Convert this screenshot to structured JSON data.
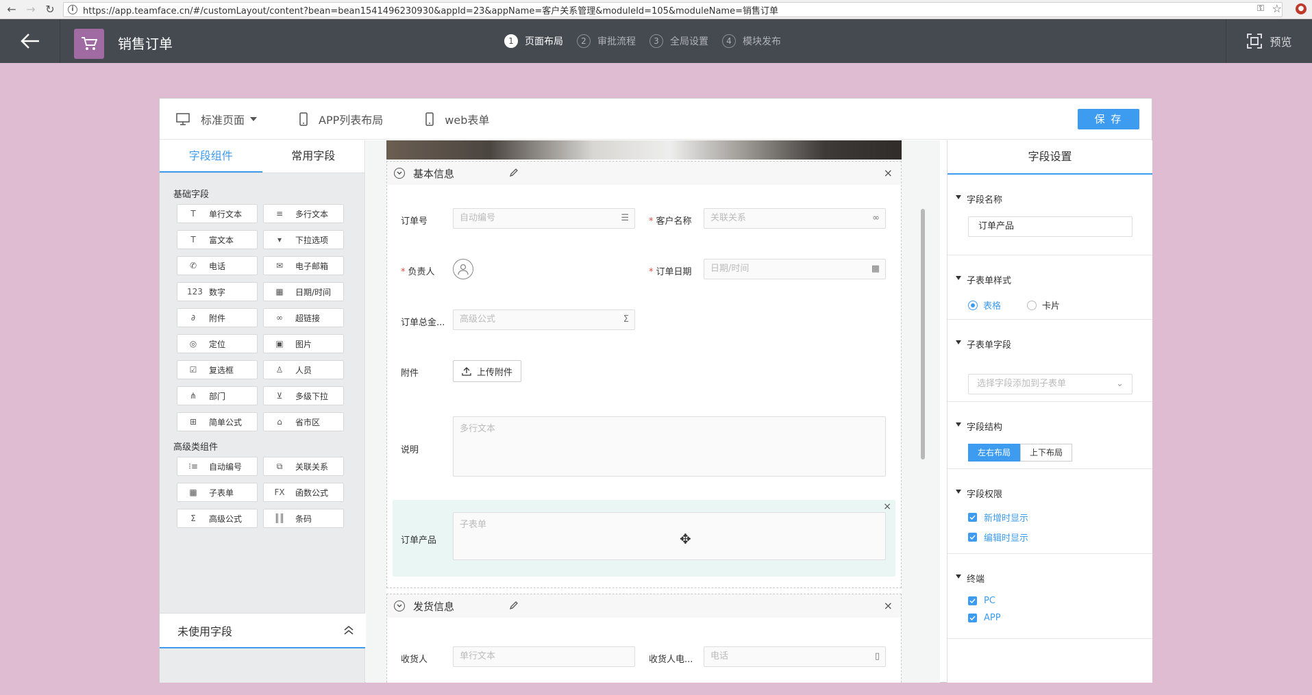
{
  "browser": {
    "url": "https://app.teamface.cn/#/customLayout/content?bean=bean1541496230930&appId=23&appName=客户关系管理&moduleId=105&moduleName=销售订单"
  },
  "header": {
    "title": "销售订单",
    "steps": [
      {
        "num": "1",
        "label": "页面布局",
        "active": true
      },
      {
        "num": "2",
        "label": "审批流程",
        "active": false
      },
      {
        "num": "3",
        "label": "全局设置",
        "active": false
      },
      {
        "num": "4",
        "label": "模块发布",
        "active": false
      }
    ],
    "preview_label": "预览",
    "app_icon_color": "#a06aa3",
    "header_bg": "#454a50"
  },
  "toolbar": {
    "standard_page": "标准页面",
    "app_list_layout": "APP列表布局",
    "web_form": "web表单",
    "save_label": "保 存"
  },
  "left": {
    "tabs": [
      "字段组件",
      "常用字段"
    ],
    "basic_title": "基础字段",
    "basic": [
      {
        "label": "单行文本",
        "icon": "single-text-icon",
        "glyph": "T"
      },
      {
        "label": "多行文本",
        "icon": "multi-text-icon",
        "glyph": "≡"
      },
      {
        "label": "富文本",
        "icon": "rich-text-icon",
        "glyph": "T"
      },
      {
        "label": "下拉选项",
        "icon": "dropdown-icon",
        "glyph": "▾"
      },
      {
        "label": "电话",
        "icon": "phone-icon",
        "glyph": "✆"
      },
      {
        "label": "电子邮箱",
        "icon": "mail-icon",
        "glyph": "✉"
      },
      {
        "label": "数字",
        "icon": "number-icon",
        "glyph": "123"
      },
      {
        "label": "日期/时间",
        "icon": "calendar-icon",
        "glyph": "▦"
      },
      {
        "label": "附件",
        "icon": "attachment-icon",
        "glyph": "∂"
      },
      {
        "label": "超链接",
        "icon": "link-icon",
        "glyph": "∞"
      },
      {
        "label": "定位",
        "icon": "location-icon",
        "glyph": "◎"
      },
      {
        "label": "图片",
        "icon": "image-icon",
        "glyph": "▣"
      },
      {
        "label": "复选框",
        "icon": "checkbox-icon",
        "glyph": "☑"
      },
      {
        "label": "人员",
        "icon": "person-icon",
        "glyph": "♙"
      },
      {
        "label": "部门",
        "icon": "department-icon",
        "glyph": "⋔"
      },
      {
        "label": "多级下拉",
        "icon": "multi-dropdown-icon",
        "glyph": "⊻"
      },
      {
        "label": "简单公式",
        "icon": "simple-formula-icon",
        "glyph": "⊞"
      },
      {
        "label": "省市区",
        "icon": "region-icon",
        "glyph": "⌂"
      }
    ],
    "advanced_title": "高级类组件",
    "advanced": [
      {
        "label": "自动编号",
        "icon": "auto-number-icon",
        "glyph": "⁝≡"
      },
      {
        "label": "关联关系",
        "icon": "relation-icon",
        "glyph": "⧉"
      },
      {
        "label": "子表单",
        "icon": "subform-icon",
        "glyph": "▦"
      },
      {
        "label": "函数公式",
        "icon": "function-icon",
        "glyph": "FX"
      },
      {
        "label": "高级公式",
        "icon": "sigma-icon",
        "glyph": "Σ"
      },
      {
        "label": "条码",
        "icon": "barcode-icon",
        "glyph": "║║"
      }
    ],
    "unused_label": "未使用字段"
  },
  "form": {
    "section1": {
      "title": "基本信息",
      "order_no_label": "订单号",
      "order_no_placeholder": "自动编号",
      "customer_label": "客户名称",
      "customer_placeholder": "关联关系",
      "owner_label": "负责人",
      "date_label": "订单日期",
      "date_placeholder": "日期/时间",
      "total_label": "订单总金...",
      "total_placeholder": "高级公式",
      "attach_label": "附件",
      "upload_label": "上传附件",
      "remark_label": "说明",
      "remark_placeholder": "多行文本",
      "product_label": "订单产品",
      "product_placeholder": "子表单"
    },
    "section2": {
      "title": "发货信息",
      "receiver_label": "收货人",
      "receiver_placeholder": "单行文本",
      "receiver_phone_label": "收货人电...",
      "receiver_phone_placeholder": "电话"
    }
  },
  "right": {
    "title": "字段设置",
    "name_title": "字段名称",
    "name_value": "订单产品",
    "style_title": "子表单样式",
    "style_options": [
      "表格",
      "卡片"
    ],
    "fields_title": "子表单字段",
    "fields_placeholder": "选择字段添加到子表单",
    "structure_title": "字段结构",
    "structure_options": [
      "左右布局",
      "上下布局"
    ],
    "permission_title": "字段权限",
    "permissions": [
      "新增时显示",
      "编辑时显示"
    ],
    "terminal_title": "终端",
    "terminals": [
      "PC",
      "APP"
    ],
    "accent": "#3d9cf0"
  }
}
